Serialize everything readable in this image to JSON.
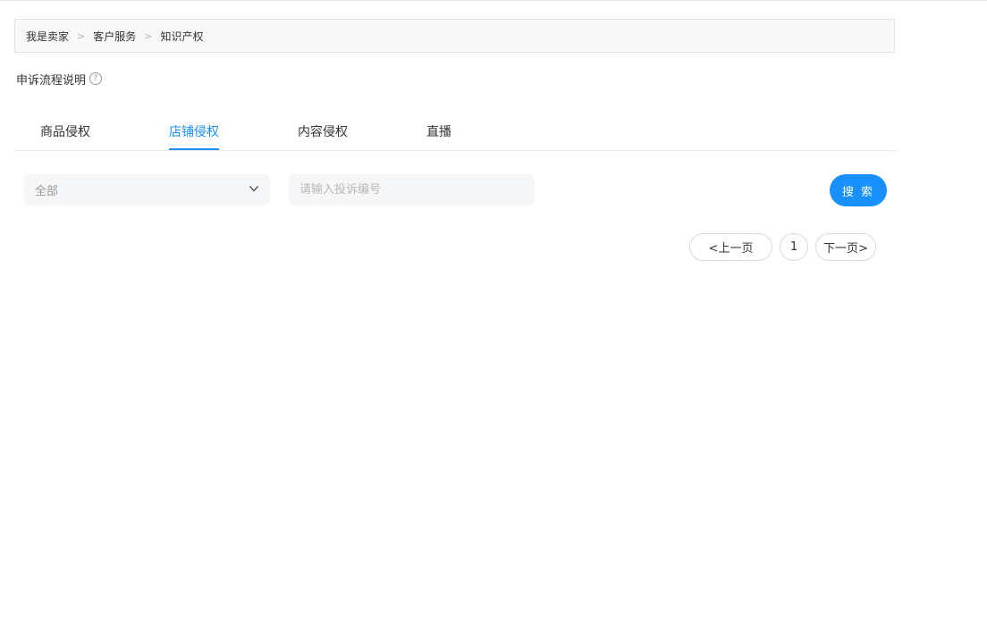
{
  "breadcrumb": {
    "items": [
      "我是卖家",
      "客户服务",
      "知识产权"
    ],
    "separator": ">"
  },
  "help": {
    "label": "申诉流程说明",
    "icon": "question-circle-icon"
  },
  "tabs": [
    {
      "label": "商品侵权",
      "active": false
    },
    {
      "label": "店铺侵权",
      "active": true
    },
    {
      "label": "内容侵权",
      "active": false
    },
    {
      "label": "直播",
      "active": false
    }
  ],
  "filter": {
    "select_value": "全部",
    "search_placeholder": "请输入投诉编号",
    "search_value": "",
    "search_button": "搜 索"
  },
  "pagination": {
    "prev_label": "<上一页",
    "current_page": "1",
    "next_label": "下一页>"
  },
  "colors": {
    "accent": "#1890ff",
    "field_bg": "#f5f6f8",
    "breadcrumb_bg": "#f8f8f8"
  }
}
